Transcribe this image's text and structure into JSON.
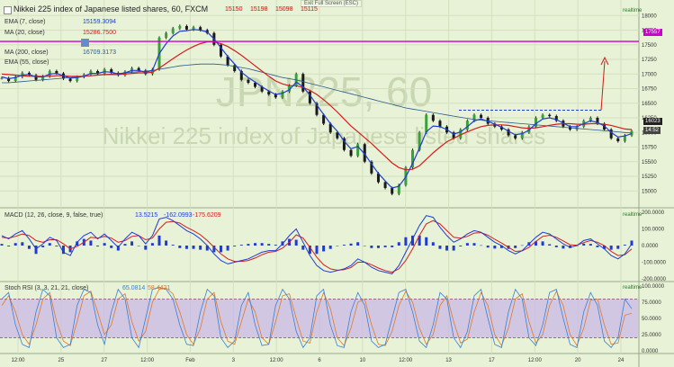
{
  "header": {
    "title": "Nikkei 225 index of Japanese listed shares, 60, FXCM",
    "ohlc": [
      "15150",
      "15198",
      "15098",
      "15115"
    ],
    "exit_fullscreen": "Exit Full Screen (ESC)",
    "watermark_symbol": "JPN225, 60",
    "watermark_name": "Nikkei 225 index of Japanese listed shares"
  },
  "legend": [
    {
      "label": "EMA (7, close)",
      "value": "15159.3094",
      "color": "#1e3cd2"
    },
    {
      "label": "MA (20, close)",
      "value": "15286.7500",
      "color": "#d21e1e"
    },
    {
      "label": "MA (200, close)",
      "value": "16709.3173",
      "color": "#2b5a8c"
    },
    {
      "label": "EMA (55, close)",
      "value": "",
      "color": "#c0702a"
    }
  ],
  "indicators": {
    "macd_label": "MACD (12, 26, close, 9, false, true)",
    "macd_values": [
      "13.5215",
      "-162.0993",
      "-175.6209"
    ],
    "stoch_label": "Stoch RSI (3, 3, 21, 21, close)",
    "stoch_values": [
      "65.0814",
      "58.4421"
    ],
    "realtime": "realtime"
  },
  "price_tags": {
    "resistance": "17557",
    "last": "16023",
    "time": "14:52"
  },
  "colors": {
    "background": "#e8f2d6",
    "ema": "#1e3cd2",
    "ma20": "#d21e1e",
    "ma200": "#2b5a8c",
    "resistance_line": "#cc00cc",
    "stoch_band": "#c9b8e6",
    "stoch_k": "#3a7fd4",
    "stoch_d": "#e0782a"
  },
  "chart_data": {
    "type": "line",
    "x_labels": [
      "12:00",
      "25",
      "27",
      "12:00",
      "Feb",
      "3",
      "12:00",
      "6",
      "10",
      "12:00",
      "13",
      "17",
      "12:00",
      "20",
      "24"
    ],
    "y_ticks": [
      "18000",
      "17750",
      "17500",
      "17250",
      "17000",
      "16750",
      "16500",
      "16250",
      "16000",
      "15750",
      "15500",
      "15250",
      "15000"
    ],
    "ylim": [
      14850,
      18050
    ],
    "resistance_level": 17557,
    "channel_top": 16380,
    "close_series": [
      16930,
      16880,
      16950,
      17020,
      16980,
      16900,
      16960,
      17050,
      17010,
      16920,
      16880,
      16950,
      16990,
      17050,
      17000,
      17080,
      17020,
      16980,
      17040,
      17100,
      17060,
      17000,
      17080,
      17620,
      17700,
      17780,
      17820,
      17760,
      17800,
      17750,
      17700,
      17500,
      17300,
      17150,
      17050,
      16900,
      16850,
      16780,
      16700,
      16650,
      16600,
      16700,
      16800,
      17000,
      16700,
      16500,
      16300,
      16150,
      16000,
      15900,
      15700,
      15600,
      15800,
      15500,
      15300,
      15150,
      15050,
      14950,
      15100,
      15400,
      15700,
      16000,
      16300,
      16200,
      16100,
      16000,
      15900,
      16050,
      16200,
      16300,
      16250,
      16150,
      16100,
      16050,
      15950,
      15900,
      16000,
      16100,
      16250,
      16300,
      16280,
      16200,
      16100,
      16050,
      16100,
      16200,
      16250,
      16150,
      16050,
      15900,
      15850,
      15950,
      16023
    ],
    "ema7": [
      16950,
      16920,
      16940,
      16980,
      16990,
      16950,
      16950,
      17000,
      17010,
      16970,
      16930,
      16940,
      16960,
      17010,
      17010,
      17040,
      17030,
      17000,
      17020,
      17060,
      17060,
      17030,
      17060,
      17350,
      17520,
      17650,
      17730,
      17740,
      17760,
      17750,
      17720,
      17600,
      17450,
      17300,
      17170,
      17030,
      16940,
      16860,
      16780,
      16710,
      16650,
      16670,
      16730,
      16860,
      16780,
      16640,
      16470,
      16310,
      16150,
      16020,
      15850,
      15720,
      15760,
      15630,
      15460,
      15300,
      15170,
      15050,
      15080,
      15240,
      15470,
      15730,
      16010,
      16110,
      16100,
      16050,
      15970,
      16010,
      16100,
      16200,
      16230,
      16190,
      16140,
      16090,
      16020,
      15960,
      15980,
      16040,
      16150,
      16230,
      16250,
      16220,
      16160,
      16100,
      16100,
      16150,
      16200,
      16170,
      16110,
      16000,
      15920,
      15940,
      15980
    ],
    "ma20": [
      17000,
      16990,
      16980,
      16970,
      16960,
      16960,
      16960,
      16960,
      16970,
      16970,
      16960,
      16960,
      16960,
      16970,
      16980,
      16990,
      16990,
      16990,
      17000,
      17010,
      17020,
      17020,
      17030,
      17100,
      17180,
      17260,
      17340,
      17410,
      17470,
      17520,
      17550,
      17550,
      17520,
      17470,
      17400,
      17320,
      17230,
      17140,
      17050,
      16960,
      16880,
      16830,
      16800,
      16800,
      16770,
      16720,
      16650,
      16560,
      16460,
      16350,
      16230,
      16110,
      16010,
      15910,
      15810,
      15700,
      15590,
      15480,
      15400,
      15360,
      15370,
      15430,
      15540,
      15650,
      15750,
      15840,
      15900,
      15960,
      16010,
      16060,
      16100,
      16120,
      16130,
      16130,
      16120,
      16100,
      16080,
      16070,
      16080,
      16100,
      16120,
      16140,
      16150,
      16150,
      16140,
      16140,
      16150,
      16150,
      16140,
      16120,
      16090,
      16060,
      16050
    ],
    "ma200": [
      16850,
      16850,
      16860,
      16870,
      16880,
      16890,
      16900,
      16910,
      16920,
      16930,
      16940,
      16950,
      16960,
      16970,
      16980,
      16990,
      17000,
      17010,
      17020,
      17030,
      17040,
      17050,
      17060,
      17080,
      17100,
      17120,
      17140,
      17150,
      17160,
      17170,
      17170,
      17170,
      17160,
      17150,
      17130,
      17110,
      17090,
      17060,
      17030,
      17000,
      16970,
      16940,
      16920,
      16900,
      16870,
      16840,
      16810,
      16780,
      16750,
      16720,
      16690,
      16660,
      16630,
      16600,
      16570,
      16540,
      16510,
      16480,
      16450,
      16420,
      16400,
      16380,
      16360,
      16340,
      16320,
      16300,
      16280,
      16260,
      16240,
      16220,
      16210,
      16200,
      16190,
      16180,
      16170,
      16160,
      16150,
      16140,
      16130,
      16120,
      16110,
      16100,
      16090,
      16080,
      16070,
      16060,
      16050,
      16040,
      16030,
      16020,
      16010,
      16000,
      15990
    ],
    "macd_ylim": [
      -200,
      200
    ],
    "macd_ticks": [
      "200.0000",
      "100.0000",
      "0.0000",
      "-100.0000",
      "-200.0000"
    ],
    "macd_line": [
      60,
      40,
      70,
      90,
      40,
      -20,
      10,
      50,
      30,
      -40,
      -60,
      20,
      60,
      80,
      40,
      70,
      30,
      -10,
      40,
      80,
      60,
      10,
      60,
      160,
      170,
      150,
      120,
      90,
      70,
      40,
      0,
      -50,
      -90,
      -110,
      -100,
      -90,
      -80,
      -60,
      -40,
      -30,
      -30,
      10,
      60,
      100,
      20,
      -60,
      -120,
      -150,
      -160,
      -150,
      -140,
      -120,
      -80,
      -100,
      -130,
      -150,
      -160,
      -170,
      -120,
      -40,
      40,
      120,
      180,
      170,
      110,
      60,
      20,
      40,
      70,
      90,
      80,
      50,
      20,
      0,
      -30,
      -50,
      -30,
      10,
      50,
      80,
      70,
      40,
      10,
      -10,
      0,
      30,
      40,
      10,
      -20,
      -60,
      -80,
      -50,
      10
    ],
    "macd_signal": [
      50,
      45,
      55,
      70,
      60,
      30,
      20,
      35,
      35,
      10,
      -20,
      -5,
      20,
      50,
      45,
      55,
      45,
      20,
      30,
      55,
      60,
      35,
      45,
      100,
      140,
      145,
      135,
      110,
      90,
      65,
      30,
      -10,
      -50,
      -80,
      -95,
      -95,
      -90,
      -75,
      -55,
      -40,
      -35,
      -15,
      20,
      65,
      45,
      -10,
      -70,
      -115,
      -140,
      -148,
      -145,
      -132,
      -100,
      -100,
      -115,
      -135,
      -150,
      -160,
      -140,
      -90,
      -20,
      60,
      130,
      150,
      130,
      90,
      50,
      45,
      55,
      75,
      78,
      62,
      38,
      15,
      -10,
      -35,
      -32,
      -10,
      25,
      55,
      62,
      50,
      28,
      5,
      2,
      18,
      30,
      20,
      0,
      -35,
      -60,
      -55,
      -20
    ],
    "stoch_ylim": [
      0,
      100
    ],
    "stoch_ticks": [
      "100.0000",
      "75.0000",
      "50.0000",
      "25.0000",
      "0.0000"
    ],
    "stoch_band": [
      20,
      80
    ],
    "stoch_k": [
      80,
      90,
      40,
      10,
      5,
      60,
      95,
      85,
      20,
      5,
      10,
      70,
      95,
      90,
      40,
      10,
      60,
      95,
      80,
      20,
      5,
      50,
      95,
      98,
      95,
      80,
      40,
      10,
      8,
      60,
      95,
      85,
      20,
      5,
      15,
      70,
      90,
      40,
      8,
      10,
      70,
      95,
      80,
      30,
      5,
      20,
      85,
      95,
      40,
      8,
      5,
      60,
      90,
      70,
      15,
      5,
      10,
      50,
      90,
      95,
      60,
      15,
      5,
      40,
      90,
      80,
      20,
      5,
      30,
      85,
      95,
      50,
      10,
      5,
      60,
      95,
      80,
      20,
      8,
      40,
      90,
      95,
      50,
      10,
      5,
      60,
      90,
      70,
      15,
      5,
      20,
      80,
      65
    ],
    "stoch_d": [
      70,
      85,
      60,
      25,
      10,
      40,
      80,
      90,
      45,
      15,
      8,
      45,
      85,
      92,
      60,
      25,
      40,
      80,
      88,
      45,
      15,
      30,
      75,
      95,
      97,
      88,
      60,
      25,
      10,
      35,
      80,
      90,
      45,
      15,
      10,
      45,
      80,
      60,
      20,
      10,
      45,
      85,
      88,
      50,
      15,
      12,
      60,
      90,
      65,
      20,
      8,
      35,
      75,
      80,
      40,
      10,
      8,
      30,
      70,
      92,
      75,
      35,
      10,
      25,
      70,
      85,
      45,
      12,
      18,
      60,
      90,
      70,
      25,
      8,
      35,
      80,
      88,
      45,
      12,
      25,
      70,
      92,
      70,
      25,
      8,
      35,
      78,
      80,
      40,
      10,
      12,
      55,
      58
    ]
  }
}
